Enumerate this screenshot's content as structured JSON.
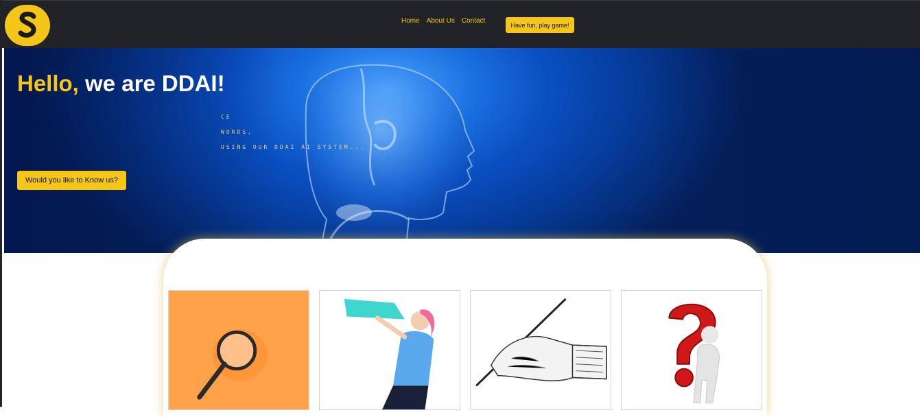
{
  "navbar": {
    "logo_letter": "S",
    "links": [
      {
        "label": "Home"
      },
      {
        "label": "About Us"
      },
      {
        "label": "Contact"
      }
    ],
    "play_button_label": "Have fun, play game!"
  },
  "hero": {
    "title_accent": "Hello,",
    "title_rest": " we are DDAI!",
    "typed_lines": [
      "CE",
      "WORDS,",
      " USING OUR DDAI AI SYSTEM..."
    ],
    "cta_label": "Would you like to Know us?"
  },
  "cards": [
    {
      "icon": "magnifying-glass-icon"
    },
    {
      "icon": "megaphone-girl-icon"
    },
    {
      "icon": "hand-writing-pen-icon"
    },
    {
      "icon": "question-mark-figure-icon"
    }
  ],
  "colors": {
    "accent": "#f5c518",
    "navbar_bg": "#222328",
    "hero_blue": "#0a4fc2"
  }
}
